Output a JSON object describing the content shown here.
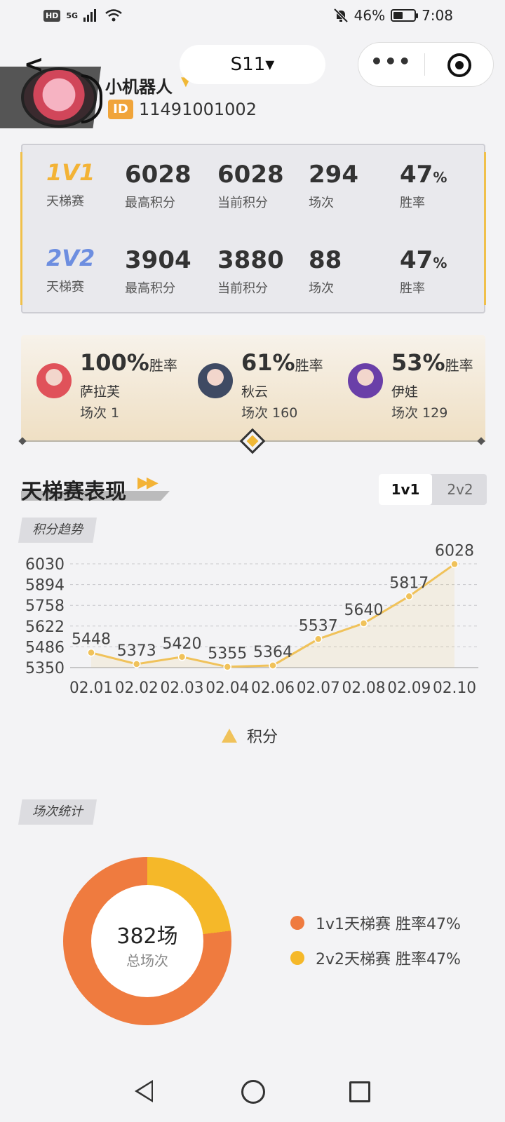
{
  "status_bar": {
    "hd": "HD",
    "network": "5G",
    "battery_text": "46%",
    "battery_level": 0.46,
    "time": "7:08"
  },
  "header": {
    "season": "S11▾",
    "user_name": "小机器人",
    "id_label": "ID",
    "user_id": "11491001002",
    "menu_dots": "•••"
  },
  "ladder_stats": [
    {
      "mode": "1V1",
      "mode_sub": "天梯赛",
      "highest": "6028",
      "highest_label": "最高积分",
      "current": "6028",
      "current_label": "当前积分",
      "matches": "294",
      "matches_label": "场次",
      "winrate": "47",
      "winrate_unit": "%",
      "winrate_label": "胜率"
    },
    {
      "mode": "2V2",
      "mode_sub": "天梯赛",
      "highest": "3904",
      "highest_label": "最高积分",
      "current": "3880",
      "current_label": "当前积分",
      "matches": "88",
      "matches_label": "场次",
      "winrate": "47",
      "winrate_unit": "%",
      "winrate_label": "胜率"
    }
  ],
  "top_heroes": [
    {
      "rate": "100%",
      "rate_label": "胜率",
      "name": "萨拉芙",
      "matches": "场次 1",
      "color": "#e0525a"
    },
    {
      "rate": "61%",
      "rate_label": "胜率",
      "name": "秋云",
      "matches": "场次 160",
      "color": "#3f4a63"
    },
    {
      "rate": "53%",
      "rate_label": "胜率",
      "name": "伊娃",
      "matches": "场次 129",
      "color": "#6a3fa8"
    }
  ],
  "performance": {
    "title": "天梯赛表现",
    "arrows": "▶▶",
    "toggle": {
      "active": "1v1",
      "inactive": "2v2"
    },
    "trend_tag": "积分趋势",
    "count_tag": "场次统计"
  },
  "chart_data": {
    "type": "line",
    "categories": [
      "02.01",
      "02.02",
      "02.03",
      "02.04",
      "02.06",
      "02.07",
      "02.08",
      "02.09",
      "02.10"
    ],
    "series": [
      {
        "name": "积分",
        "values": [
          5448,
          5373,
          5420,
          5355,
          5364,
          5537,
          5640,
          5817,
          6028
        ]
      }
    ],
    "y_ticks": [
      6030,
      5894,
      5758,
      5622,
      5486,
      5350
    ],
    "ylim": [
      5350,
      6030
    ],
    "grid": true,
    "legend": "bottom",
    "color": "#f0c25a"
  },
  "match_stats": {
    "total": "382场",
    "total_label": "总场次",
    "segments": [
      {
        "label": "1v1天梯赛 胜率47%",
        "value": 294,
        "color": "#ef7b3f"
      },
      {
        "label": "2v2天梯赛 胜率47%",
        "value": 88,
        "color": "#f5b829"
      }
    ]
  }
}
